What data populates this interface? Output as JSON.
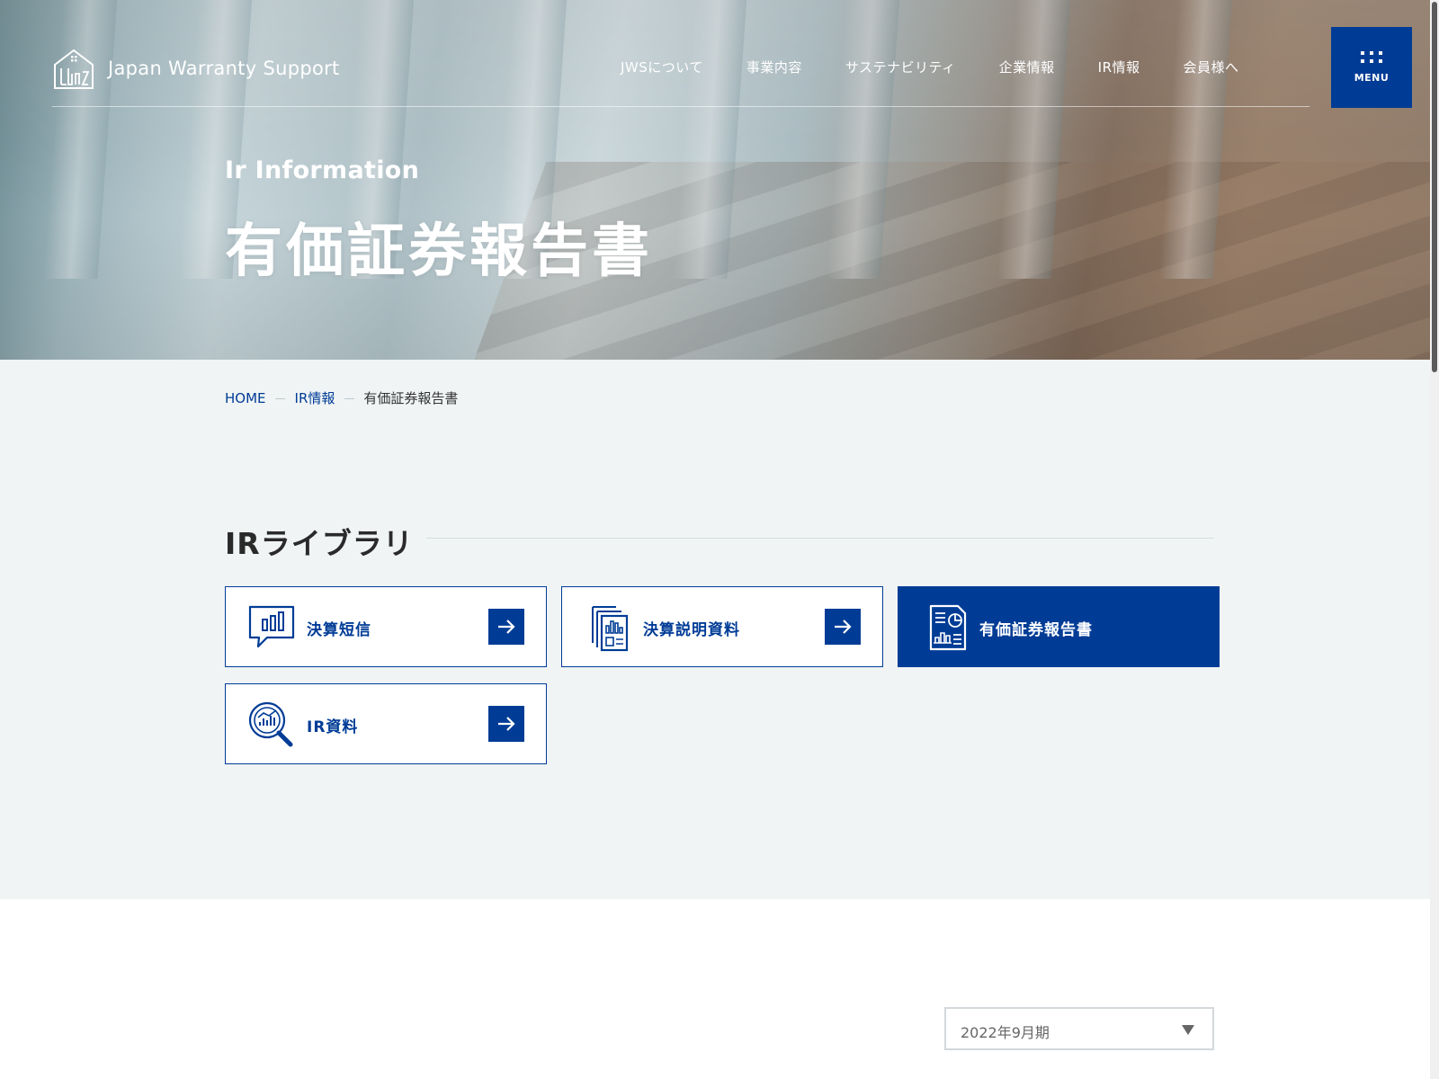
{
  "header": {
    "logo_text": "Japan Warranty Support",
    "nav": [
      {
        "label": "JWSについて"
      },
      {
        "label": "事業内容"
      },
      {
        "label": "サステナビリティ"
      },
      {
        "label": "企業情報"
      },
      {
        "label": "IR情報"
      },
      {
        "label": "会員様へ"
      }
    ],
    "menu_label": "MENU"
  },
  "hero": {
    "subtitle_en": "Ir Information",
    "title_ja": "有価証券報告書"
  },
  "breadcrumb": {
    "home": "HOME",
    "ir": "IR情報",
    "current": "有価証券報告書"
  },
  "library": {
    "title": "IRライブラリ",
    "cards": [
      {
        "label": "決算短信",
        "icon": "chart-speech-bubble-icon",
        "active": false
      },
      {
        "label": "決算説明資料",
        "icon": "documents-icon",
        "active": false
      },
      {
        "label": "有価証券報告書",
        "icon": "report-document-icon",
        "active": true
      },
      {
        "label": "IR資料",
        "icon": "magnifier-chart-icon",
        "active": false
      }
    ]
  },
  "filter": {
    "selected": "2022年9月期"
  },
  "colors": {
    "brand": "#003c96",
    "section_bg": "#f0f4f5"
  }
}
